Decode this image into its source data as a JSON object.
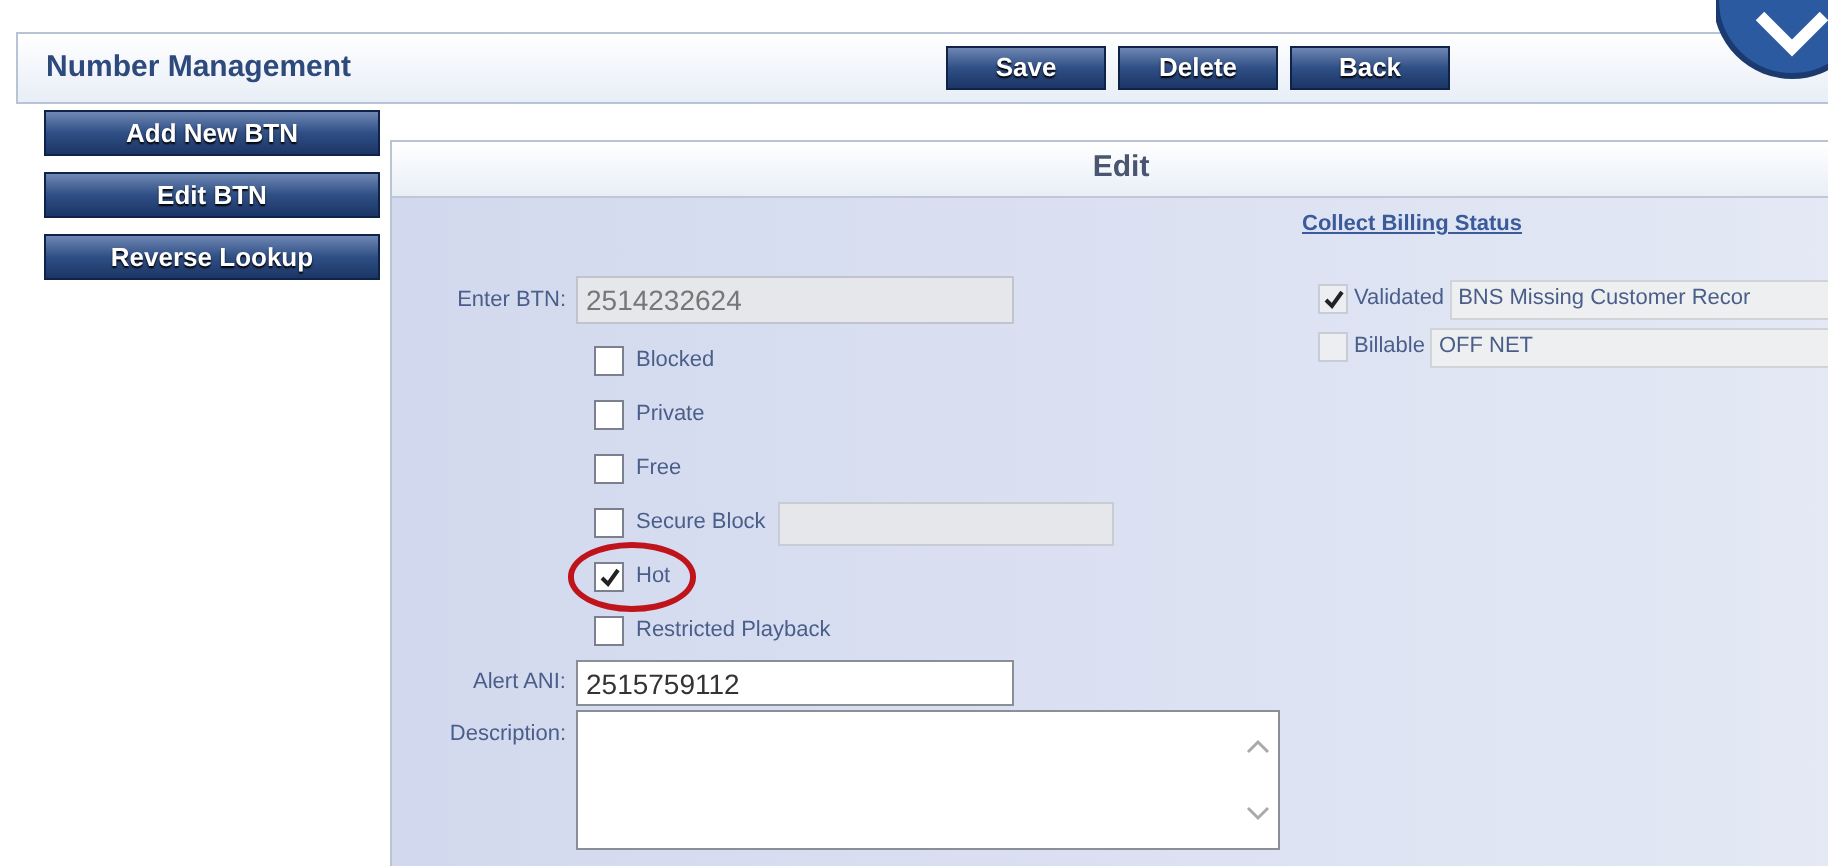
{
  "header": {
    "title": "Number Management",
    "buttons": [
      "Save",
      "Delete",
      "Back"
    ]
  },
  "sidebar": {
    "buttons": [
      "Add New BTN",
      "Edit BTN",
      "Reverse Lookup"
    ]
  },
  "panel": {
    "title": "Edit",
    "enter_btn": {
      "label": "Enter BTN:",
      "value": "2514232624"
    },
    "checkboxes": [
      {
        "label": "Blocked",
        "checked": false,
        "kind": "plain",
        "highlighted": false
      },
      {
        "label": "Private",
        "checked": false,
        "kind": "plain",
        "highlighted": false
      },
      {
        "label": "Free",
        "checked": false,
        "kind": "plain",
        "highlighted": false
      },
      {
        "label": "Secure Block",
        "checked": false,
        "kind": "with_field",
        "highlighted": false
      },
      {
        "label": "Hot",
        "checked": true,
        "kind": "plain",
        "highlighted": true
      },
      {
        "label": "Restricted Playback",
        "checked": false,
        "kind": "plain",
        "highlighted": false
      }
    ],
    "alert_ani": {
      "label": "Alert ANI:",
      "value": "2515759112"
    },
    "description": {
      "label": "Description:"
    },
    "billing": {
      "title": "Collect Billing Status",
      "items": [
        {
          "label": "Validated",
          "checked": true,
          "value": "BNS Missing Customer Recor"
        },
        {
          "label": "Billable",
          "checked": false,
          "value": "OFF NET"
        }
      ]
    }
  }
}
